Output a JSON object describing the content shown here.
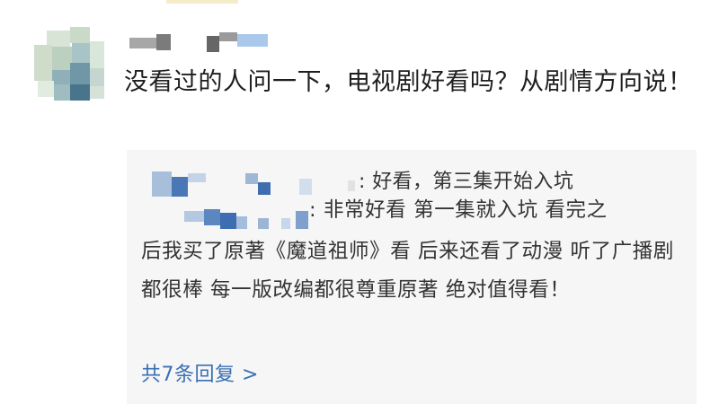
{
  "comment": {
    "text": "没看过的人问一下，电视剧好看吗？从剧情方向说！"
  },
  "replies": [
    {
      "separator": ":",
      "text": "好看，第三集开始入坑"
    },
    {
      "separator": ":",
      "text_first": "非常好看 第一集就入坑 看完之",
      "text_rest": "后我买了原著《魔道祖师》看 后来还看了动漫 听了广播剧 都很棒 每一版改编都很尊重原著 绝对值得看！"
    }
  ],
  "more_replies": {
    "label": "共7条回复 >"
  },
  "colors": {
    "link": "#3a6fb5",
    "reply_bg": "#f6f6f6",
    "text": "#1f1f1f"
  }
}
